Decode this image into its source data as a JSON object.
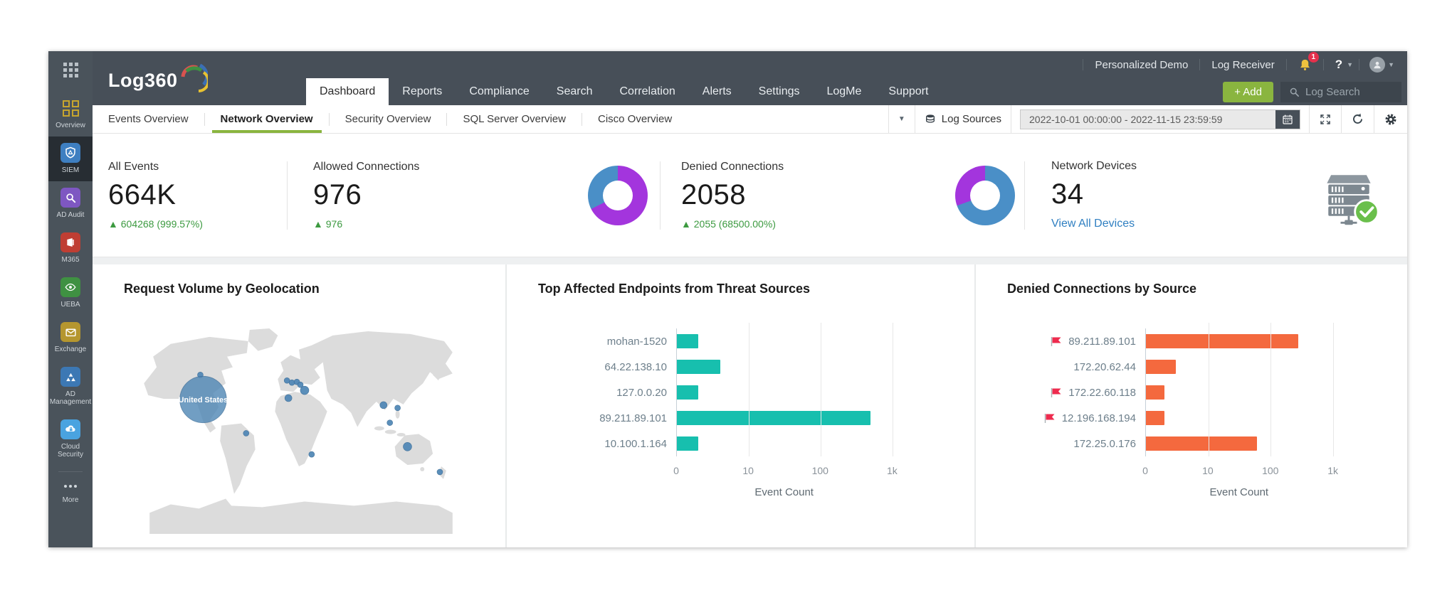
{
  "brand": {
    "name": "Log360"
  },
  "topbar": {
    "demo_label": "Personalized Demo",
    "log_receiver_label": "Log Receiver",
    "notification_count": "1",
    "help_label": "?"
  },
  "nav": {
    "tabs": [
      "Dashboard",
      "Reports",
      "Compliance",
      "Search",
      "Correlation",
      "Alerts",
      "Settings",
      "LogMe",
      "Support"
    ],
    "active": "Dashboard",
    "add_label": "+ Add",
    "search_placeholder": "Log Search"
  },
  "sidebar": {
    "items": [
      {
        "label": "Overview",
        "active": false
      },
      {
        "label": "SIEM",
        "active": true
      },
      {
        "label": "AD Audit",
        "active": false
      },
      {
        "label": "M365",
        "active": false
      },
      {
        "label": "UEBA",
        "active": false
      },
      {
        "label": "Exchange",
        "active": false
      },
      {
        "label": "AD Management",
        "active": false
      },
      {
        "label": "Cloud Security",
        "active": false
      },
      {
        "label": "More",
        "active": false
      }
    ]
  },
  "subtabs": {
    "tabs": [
      "Events Overview",
      "Network Overview",
      "Security Overview",
      "SQL Server Overview",
      "Cisco Overview"
    ],
    "active": "Network Overview",
    "log_sources_label": "Log Sources",
    "date_range": "2022-10-01 00:00:00 - 2022-11-15 23:59:59"
  },
  "stats": {
    "cards": [
      {
        "label": "All Events",
        "value": "664K",
        "delta": "▲ 604268 (999.57%)"
      },
      {
        "label": "Allowed Connections",
        "value": "976",
        "delta": "▲ 976"
      },
      {
        "label": "Denied Connections",
        "value": "2058",
        "delta": "▲ 2055 (68500.00%)"
      },
      {
        "label": "Network Devices",
        "value": "34",
        "link": "View All Devices"
      }
    ],
    "donuts": [
      {
        "segments": [
          {
            "color": "#a335dd",
            "from": 0,
            "to": 243
          },
          {
            "color": "#4a8fc7",
            "from": 243,
            "to": 360
          }
        ]
      },
      {
        "segments": [
          {
            "color": "#4a8fc7",
            "from": 0,
            "to": 250
          },
          {
            "color": "#a335dd",
            "from": 250,
            "to": 360
          }
        ]
      }
    ]
  },
  "colors": {
    "teal_bar": "#17bfae",
    "orange_bar": "#f4693e",
    "map_dot": "#4e86b5",
    "accent_green": "#8ab53f",
    "link_blue": "#2f7fc1",
    "delta_green": "#3c9a40",
    "flag_red": "#ee2b4e"
  },
  "chart_data": [
    {
      "type": "map",
      "title": "Request Volume by Geolocation",
      "bubbles": [
        {
          "label": "United States",
          "x": 86,
          "y": 101,
          "r": 33
        }
      ],
      "points": [
        {
          "label": "canada",
          "x": 82,
          "y": 66,
          "r": 4
        },
        {
          "label": "uk-1",
          "x": 205,
          "y": 74,
          "r": 4
        },
        {
          "label": "uk-2",
          "x": 212,
          "y": 77,
          "r": 4
        },
        {
          "label": "europe-1",
          "x": 219,
          "y": 76,
          "r": 4
        },
        {
          "label": "europe-2",
          "x": 224,
          "y": 80,
          "r": 4
        },
        {
          "label": "germany",
          "x": 230,
          "y": 88,
          "r": 6
        },
        {
          "label": "spain",
          "x": 207,
          "y": 99,
          "r": 5
        },
        {
          "label": "china",
          "x": 342,
          "y": 109,
          "r": 5
        },
        {
          "label": "philippines",
          "x": 362,
          "y": 113,
          "r": 4
        },
        {
          "label": "indonesia",
          "x": 351,
          "y": 134,
          "r": 4
        },
        {
          "label": "brazil",
          "x": 147,
          "y": 149,
          "r": 4
        },
        {
          "label": "south-africa",
          "x": 240,
          "y": 179,
          "r": 4
        },
        {
          "label": "australia",
          "x": 376,
          "y": 168,
          "r": 6
        },
        {
          "label": "new-zealand",
          "x": 422,
          "y": 204,
          "r": 4
        }
      ]
    },
    {
      "type": "bar",
      "orientation": "horizontal",
      "scale": "log",
      "title": "Top Affected Endpoints from Threat Sources",
      "categories": [
        "mohan-1520",
        "64.22.138.10",
        "127.0.0.20",
        "89.211.89.101",
        "10.100.1.164"
      ],
      "values": [
        2,
        4,
        2,
        500,
        2
      ],
      "flags": [
        false,
        false,
        false,
        false,
        false
      ],
      "bar_color": "#17bfae",
      "xticks": [
        "0",
        "10",
        "100",
        "1k"
      ],
      "xlabel": "Event Count"
    },
    {
      "type": "bar",
      "orientation": "horizontal",
      "scale": "log",
      "title": "Denied Connections by Source",
      "categories": [
        "89.211.89.101",
        "172.20.62.44",
        "172.22.60.118",
        "12.196.168.194",
        "172.25.0.176"
      ],
      "values": [
        280,
        3,
        2,
        2,
        60
      ],
      "flags": [
        true,
        false,
        true,
        true,
        false
      ],
      "bar_color": "#f4693e",
      "xticks": [
        "0",
        "10",
        "100",
        "1k"
      ],
      "xlabel": "Event Count"
    }
  ]
}
